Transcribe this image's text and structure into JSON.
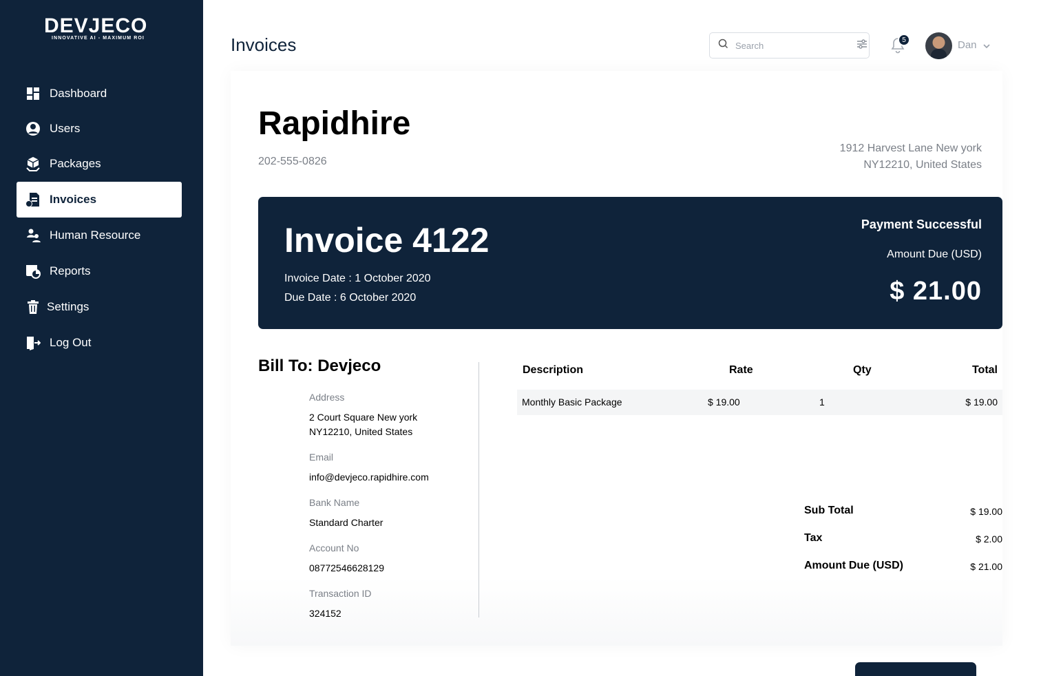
{
  "brand": {
    "name": "DEVJECO",
    "tagline": "INNOVATIVE AI - MAXIMUM ROI"
  },
  "sidebar": {
    "items": [
      {
        "label": "Dashboard",
        "icon": "dashboard-icon",
        "active": false
      },
      {
        "label": "Users",
        "icon": "user-icon",
        "active": false
      },
      {
        "label": "Packages",
        "icon": "packages-icon",
        "active": false
      },
      {
        "label": "Invoices",
        "icon": "invoice-icon",
        "active": true
      },
      {
        "label": "Human Resource",
        "icon": "human-resource-icon",
        "active": false
      },
      {
        "label": "Reports",
        "icon": "reports-icon",
        "active": false
      },
      {
        "label": "Settings",
        "icon": "trash-icon",
        "active": false
      },
      {
        "label": "Log Out",
        "icon": "logout-icon",
        "active": false
      }
    ]
  },
  "header": {
    "title": "Invoices",
    "search_placeholder": "Search",
    "notification_count": "5",
    "user_name": "Dan"
  },
  "invoice": {
    "company": "Rapidhire",
    "phone": "202-555-0826",
    "address_line1": "1912 Harvest Lane New york",
    "address_line2": "NY12210, United States",
    "title": "Invoice 4122",
    "invoice_date": "Invoice Date : 1 October 2020",
    "due_date": "Due Date : 6 October 2020",
    "status": "Payment Successful",
    "amount_label": "Amount Due (USD)",
    "amount": "$ 21.00"
  },
  "bill_to": {
    "heading": "Bill To: Devjeco",
    "address_label": "Address",
    "address_line1": "2 Court Square New york",
    "address_line2": "NY12210, United States",
    "email_label": "Email",
    "email": "info@devjeco.rapidhire.com",
    "bank_label": "Bank Name",
    "bank": "Standard Charter",
    "account_label": "Account No",
    "account": "08772546628129",
    "transaction_label": "Transaction ID",
    "transaction": "324152"
  },
  "table": {
    "headers": {
      "description": "Description",
      "rate": "Rate",
      "qty": "Qty",
      "total": "Total"
    },
    "rows": [
      {
        "description": "Monthly Basic Package",
        "rate": "$ 19.00",
        "qty": "1",
        "total": "$ 19.00"
      }
    ]
  },
  "summary": {
    "subtotal_label": "Sub Total",
    "subtotal": "$ 19.00",
    "tax_label": "Tax",
    "tax": "$ 2.00",
    "due_label": "Amount Due (USD)",
    "due": "$ 21.00"
  },
  "colors": {
    "navy": "#0f233a",
    "muted": "#7a7f87",
    "row_bg": "#f4f5f6"
  }
}
